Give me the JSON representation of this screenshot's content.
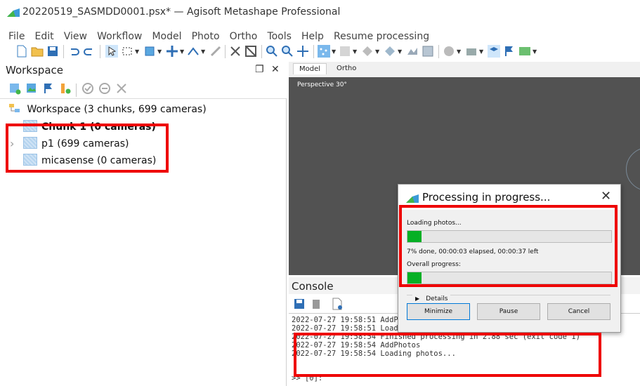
{
  "window": {
    "title": "20220519_SASMDD0001.psx* — Agisoft Metashape Professional"
  },
  "menu": {
    "items": [
      "File",
      "Edit",
      "View",
      "Workflow",
      "Model",
      "Photo",
      "Ortho",
      "Tools",
      "Help",
      "Resume processing"
    ]
  },
  "workspace": {
    "title": "Workspace",
    "float_glyph": "❐",
    "close_glyph": "✕",
    "root_label": "Workspace (3 chunks, 699 cameras)",
    "chunks": [
      {
        "label": "Chunk 1 (0 cameras)",
        "active": true
      },
      {
        "label": "p1 (699 cameras)",
        "expandable": true
      },
      {
        "label": "micasense (0 cameras)"
      }
    ],
    "expand_glyph": "›"
  },
  "view_tabs": [
    "Model",
    "Ortho"
  ],
  "viewport": {
    "projection_label": "Perspective 30°"
  },
  "console": {
    "title": "Console",
    "lines": [
      "2022-07-27 19:58:51 AddPhotos",
      "2022-07-27 19:58:51 Loading photos...",
      "2022-07-27 19:58:54 Finished processing in 2.88 sec (exit code 1)",
      "2022-07-27 19:58:54 AddPhotos",
      "2022-07-27 19:58:54 Loading photos..."
    ],
    "prompt": ">> [0]:"
  },
  "dialog": {
    "title": "Processing in progress...",
    "close_glyph": "✕",
    "task_label": "Loading photos...",
    "task_progress": 0.07,
    "status_text": "7% done, 00:00:03 elapsed, 00:00:37 left",
    "overall_label": "Overall progress:",
    "overall_progress": 0.07,
    "details_label": "Details",
    "details_glyph": "▶",
    "buttons": {
      "minimize": "Minimize",
      "pause": "Pause",
      "cancel": "Cancel"
    }
  },
  "colors": {
    "progress_fill": "#06b025",
    "annotation_red": "#ee0000",
    "viewport_bg": "#525252"
  }
}
